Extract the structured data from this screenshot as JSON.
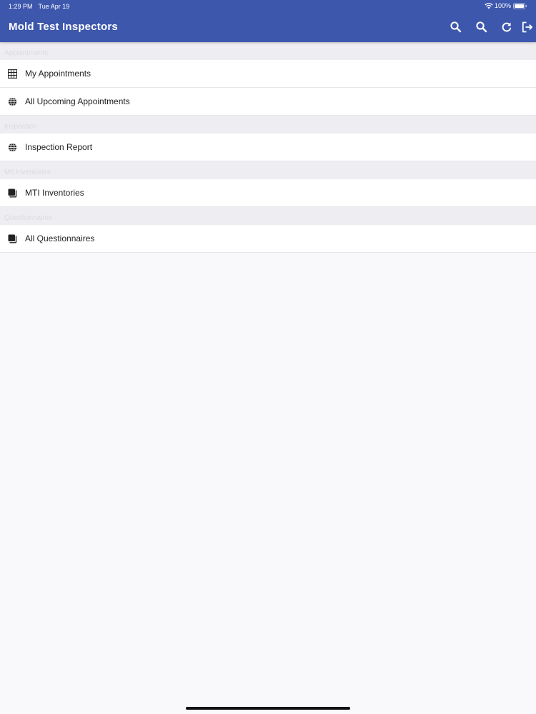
{
  "status_bar": {
    "time": "1:29 PM",
    "date": "Tue Apr 19",
    "battery": "100%"
  },
  "app_bar": {
    "title": "Mold Test Inspectors",
    "actions": [
      {
        "icon": "search-icon"
      },
      {
        "icon": "search-icon"
      },
      {
        "icon": "refresh-icon"
      },
      {
        "icon": "logout-icon"
      }
    ]
  },
  "sections": [
    {
      "header": "Appointments",
      "items": [
        {
          "label": "My Appointments",
          "icon": "grid-icon"
        },
        {
          "label": "All Upcoming Appointments",
          "icon": "globe-icon"
        }
      ]
    },
    {
      "header": "Inspection",
      "items": [
        {
          "label": "Inspection Report",
          "icon": "globe-icon"
        }
      ]
    },
    {
      "header": "Mtl Inventories",
      "items": [
        {
          "label": "MTI Inventories",
          "icon": "stack-icon"
        }
      ]
    },
    {
      "header": "Questionnaires",
      "items": [
        {
          "label": "All Questionnaires",
          "icon": "stack-icon"
        }
      ]
    }
  ],
  "colors": {
    "app_bar": "#3d57ad",
    "background": "#f9f8fb",
    "section_header": "#eeedf1"
  }
}
